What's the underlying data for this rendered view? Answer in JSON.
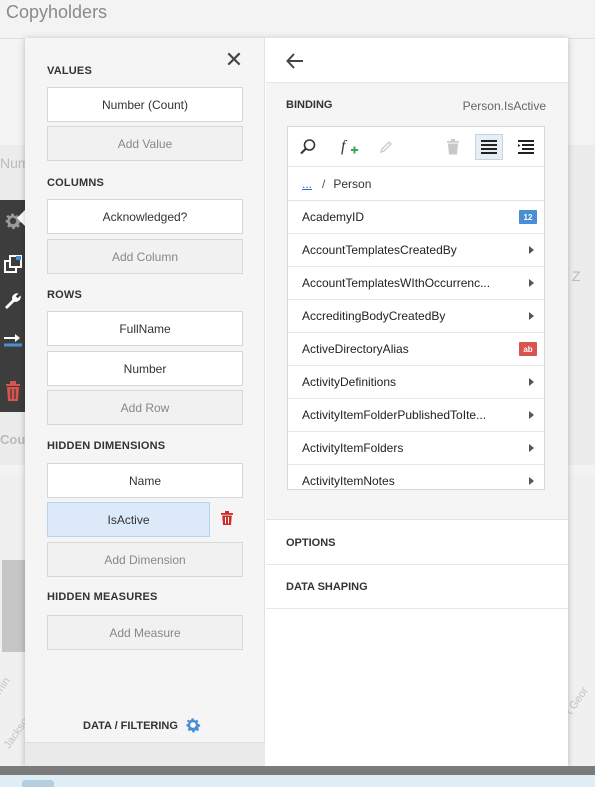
{
  "background": {
    "title": "Copyholders",
    "fragments": {
      "num": "Num",
      "z": "Z",
      "cou": "Cou",
      "jackson": "Jackson",
      "min": "min",
      "george": "t Geor"
    }
  },
  "toolbar_icons": [
    "gear-icon",
    "layers-icon",
    "wrench-icon",
    "swap-icon",
    "trash-icon"
  ],
  "left": {
    "close_icon": "close-icon",
    "sections": {
      "values": "VALUES",
      "columns": "COLUMNS",
      "rows": "ROWS",
      "hidden_dimensions": "HIDDEN DIMENSIONS",
      "hidden_measures": "HIDDEN MEASURES"
    },
    "values": [
      "Number (Count)"
    ],
    "add_value": "Add Value",
    "columns": [
      "Acknowledged?"
    ],
    "add_column": "Add Column",
    "rows": [
      "FullName",
      "Number"
    ],
    "add_row": "Add Row",
    "hidden_dimensions": [
      "Name",
      "IsActive"
    ],
    "selected_dimension": "IsActive",
    "add_dimension": "Add Dimension",
    "add_measure": "Add Measure",
    "data_filtering": "DATA / FILTERING"
  },
  "right": {
    "back_icon": "back-arrow-icon",
    "binding_label": "BINDING",
    "binding_value": "Person.IsActive",
    "tools": [
      "search-icon",
      "add-calculated-field-icon",
      "edit-icon",
      "delete-icon",
      "list-view-icon",
      "tree-view-icon"
    ],
    "breadcrumb": {
      "root": "...",
      "separator": "/",
      "current": "Person"
    },
    "fields": [
      {
        "name": "AcademyID",
        "kind": "number",
        "badge": "12"
      },
      {
        "name": "AccountTemplatesCreatedBy",
        "kind": "nav"
      },
      {
        "name": "AccountTemplatesWIthOccurrenc...",
        "kind": "nav"
      },
      {
        "name": "AccreditingBodyCreatedBy",
        "kind": "nav"
      },
      {
        "name": "ActiveDirectoryAlias",
        "kind": "string",
        "badge": "ab"
      },
      {
        "name": "ActivityDefinitions",
        "kind": "nav"
      },
      {
        "name": "ActivityItemFolderPublishedToIte...",
        "kind": "nav"
      },
      {
        "name": "ActivityItemFolders",
        "kind": "nav"
      },
      {
        "name": "ActivityItemNotes",
        "kind": "nav"
      }
    ],
    "options_label": "OPTIONS",
    "data_shaping_label": "DATA SHAPING"
  },
  "colors": {
    "accent": "#4a8fd4",
    "danger": "#d9534f",
    "selected": "#dbe9f8",
    "toolbar_bg": "#3d3d3d"
  }
}
